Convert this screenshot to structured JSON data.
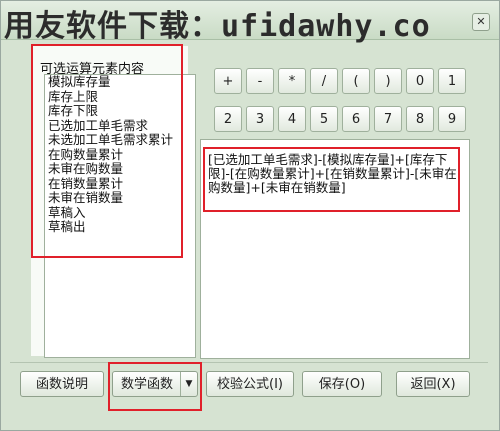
{
  "watermark": "用友软件下载：ufidawhy.co",
  "close_label": "✕",
  "left_panel": {
    "title": "可选运算元素内容",
    "items": [
      "模拟库存量",
      "库存上限",
      "库存下限",
      "已选加工单毛需求",
      "未选加工单毛需求累计",
      "在购数量累计",
      "未审在购数量",
      "在销数量累计",
      "未审在销数量",
      "草稿入",
      "草稿出"
    ]
  },
  "keypad": {
    "row1": [
      "+",
      "-",
      "*",
      "/",
      "(",
      ")",
      "0",
      "1"
    ],
    "row2": [
      "2",
      "3",
      "4",
      "5",
      "6",
      "7",
      "8",
      "9"
    ]
  },
  "expression": "[已选加工单毛需求]-[模拟库存量]+[库存下限]-[在购数量累计]+[在销数量累计]-[未审在购数量]+[未审在销数量]",
  "buttons": {
    "func_help": "函数说明",
    "math_func": "数学函数",
    "dropdown_arrow": "▼",
    "verify": "校验公式(I)",
    "save": "保存(O)",
    "back": "返回(X)"
  }
}
